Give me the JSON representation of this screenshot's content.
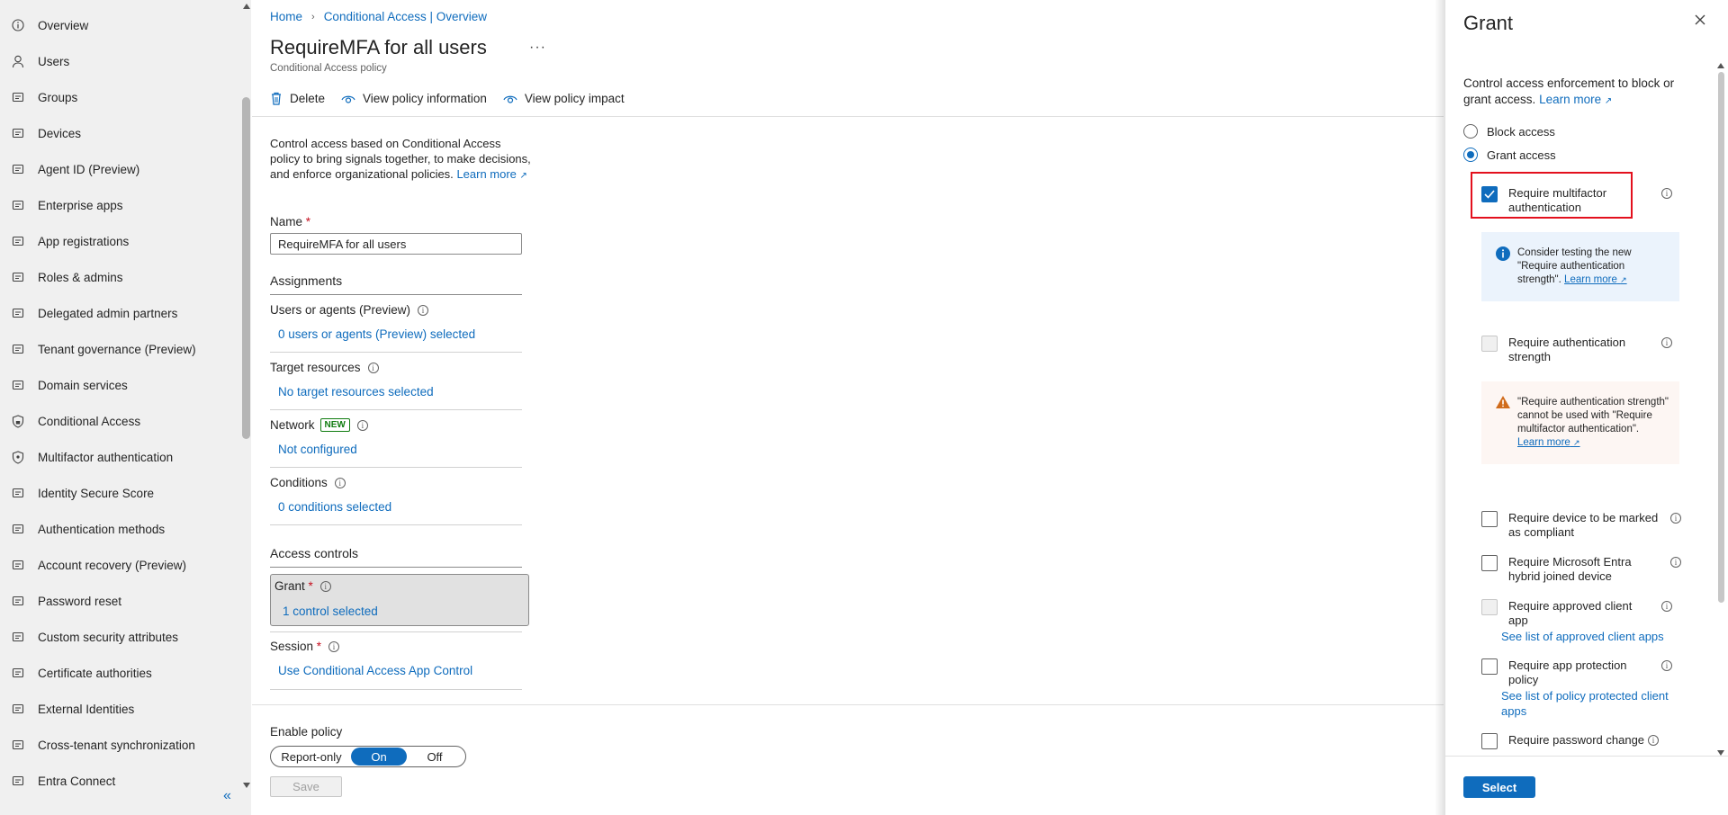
{
  "sidebar": {
    "items": [
      {
        "label": "Overview",
        "icon": "info-circle-icon"
      },
      {
        "label": "Users",
        "icon": "person-icon"
      },
      {
        "label": "Groups",
        "icon": "people-group-icon"
      },
      {
        "label": "Devices",
        "icon": "laptop-icon"
      },
      {
        "label": "Agent ID (Preview)",
        "icon": "id-card-icon"
      },
      {
        "label": "Enterprise apps",
        "icon": "enterprise-app-icon"
      },
      {
        "label": "App registrations",
        "icon": "app-grid-icon"
      },
      {
        "label": "Roles & admins",
        "icon": "person-shield-icon"
      },
      {
        "label": "Delegated admin partners",
        "icon": "people-link-icon"
      },
      {
        "label": "Tenant governance (Preview)",
        "icon": "person-settings-icon"
      },
      {
        "label": "Domain services",
        "icon": "window-icon"
      },
      {
        "label": "Conditional Access",
        "icon": "shield-lock-icon"
      },
      {
        "label": "Multifactor authentication",
        "icon": "shield-check-icon"
      },
      {
        "label": "Identity Secure Score",
        "icon": "trophy-icon"
      },
      {
        "label": "Authentication methods",
        "icon": "fingerprint-icon"
      },
      {
        "label": "Account recovery (Preview)",
        "icon": "person-key-icon"
      },
      {
        "label": "Password reset",
        "icon": "password-icon"
      },
      {
        "label": "Custom security attributes",
        "icon": "tag-list-icon"
      },
      {
        "label": "Certificate authorities",
        "icon": "certificate-icon"
      },
      {
        "label": "External Identities",
        "icon": "building-people-icon"
      },
      {
        "label": "Cross-tenant synchronization",
        "icon": "sync-icon"
      },
      {
        "label": "Entra Connect",
        "icon": "cloud-sync-icon"
      }
    ],
    "collapse_glyph": "«"
  },
  "main": {
    "breadcrumb": [
      "Home",
      "Conditional Access | Overview"
    ],
    "breadcrumb_sep": "›",
    "title": "RequireMFA for all users",
    "more_glyph": "···",
    "subtitle": "Conditional Access policy",
    "toolbar": {
      "delete": "Delete",
      "view_info": "View policy information",
      "view_impact": "View policy impact"
    },
    "description": "Control access based on Conditional Access policy to bring signals together, to make decisions, and enforce organizational policies.",
    "learn_more": "Learn more",
    "name_label": "Name",
    "required_mark": "*",
    "name_value": "RequireMFA for all users",
    "assignments_title": "Assignments",
    "users_label": "Users or agents (Preview)",
    "users_value": "0 users or agents (Preview) selected",
    "target_label": "Target resources",
    "target_value": "No target resources selected",
    "network_label": "Network",
    "network_badge": "NEW",
    "network_value": "Not configured",
    "conditions_label": "Conditions",
    "conditions_value": "0 conditions selected",
    "access_title": "Access controls",
    "grant_label": "Grant",
    "grant_value": "1 control selected",
    "session_label": "Session",
    "session_value": "Use Conditional Access App Control",
    "enable_label": "Enable policy",
    "toggle": {
      "report_only": "Report-only",
      "on": "On",
      "off": "Off",
      "selected": "On"
    },
    "save": "Save"
  },
  "panel": {
    "title": "Grant",
    "description": "Control access enforcement to block or grant access.",
    "learn_more": "Learn more",
    "block_access": "Block access",
    "grant_access": "Grant access",
    "selected_radio": "Grant access",
    "options": {
      "mfa": {
        "label": "Require multifactor authentication",
        "checked": true
      },
      "auth_strength": {
        "label": "Require authentication strength",
        "disabled": true
      },
      "compliant": {
        "label": "Require device to be marked as compliant",
        "checked": false
      },
      "hybrid": {
        "label": "Require Microsoft Entra hybrid joined device",
        "checked": false
      },
      "approved_app": {
        "label": "Require approved client app",
        "disabled": true
      },
      "app_protection": {
        "label": "Require app protection policy",
        "checked": false
      },
      "password_change": {
        "label": "Require password change",
        "checked": false
      }
    },
    "info_msg": "Consider testing the new \"Require authentication strength\".",
    "info_learn": "Learn more",
    "warn_msg": "\"Require authentication strength\" cannot be used with \"Require multifactor authentication\".",
    "warn_learn": "Learn more",
    "approved_apps_link": "See list of approved client apps",
    "protected_apps_link": "See list of policy protected client apps",
    "select": "Select"
  },
  "colors": {
    "accent": "#0f6cbd",
    "highlight": "#e3101d",
    "warning": "#d06b1a",
    "badge": "#107c10"
  }
}
